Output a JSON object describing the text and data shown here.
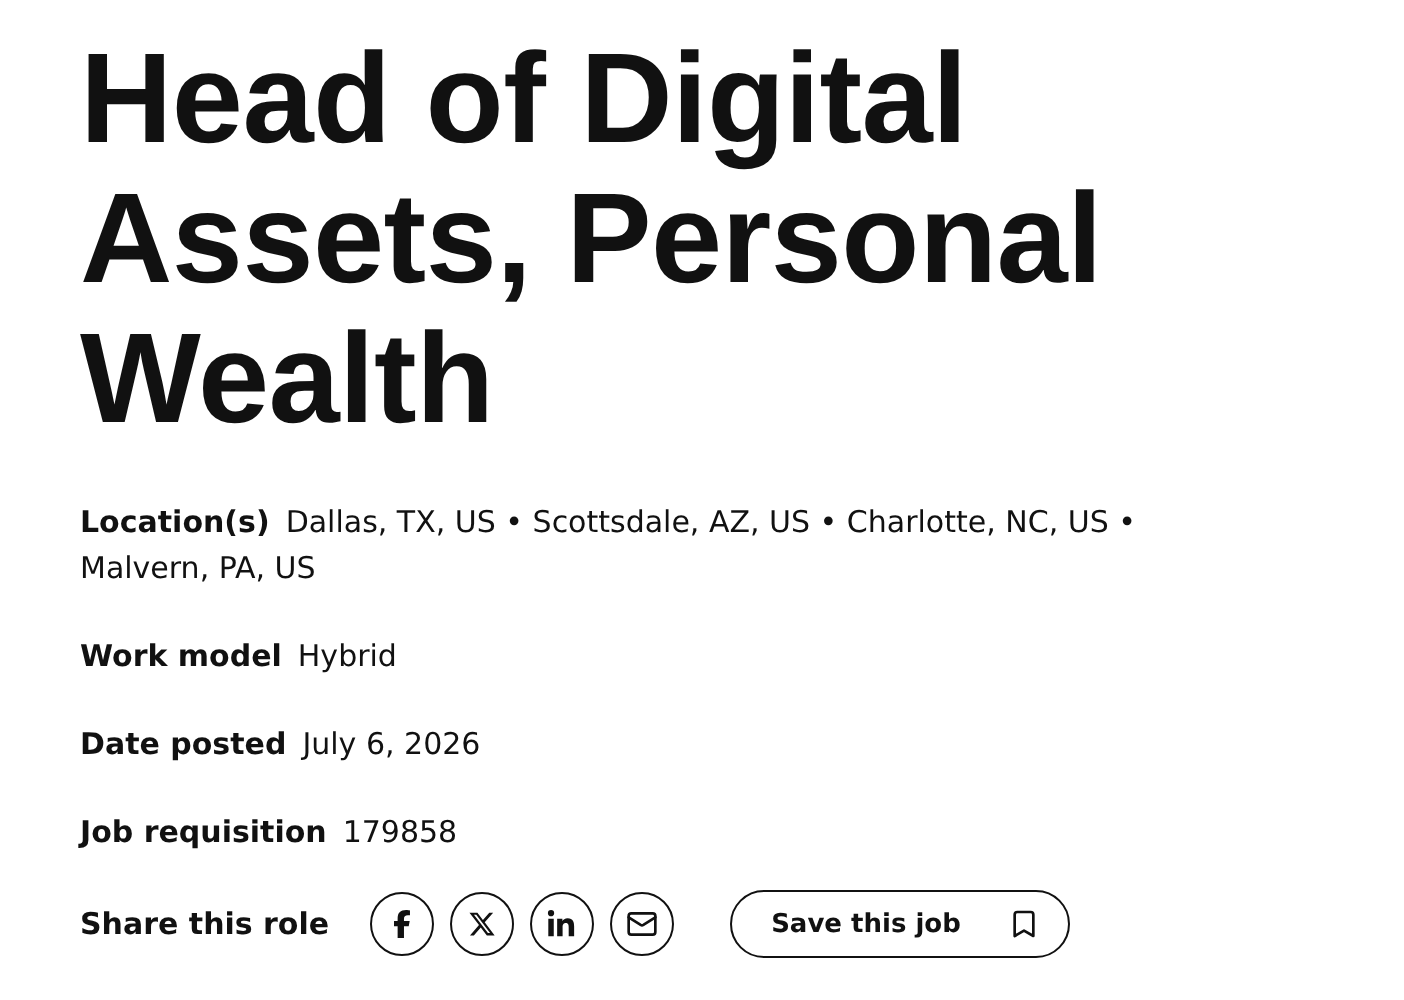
{
  "title": "Head of Digital Assets, Personal Wealth",
  "details": [
    {
      "label": "Location(s)",
      "value": "Dallas, TX, US • Scottsdale, AZ, US • Charlotte, NC, US • Malvern, PA, US"
    },
    {
      "label": "Work model",
      "value": "Hybrid"
    },
    {
      "label": "Date posted",
      "value": "July 6, 2026"
    },
    {
      "label": "Job requisition",
      "value": "179858"
    }
  ],
  "share": {
    "label": "Share this role",
    "networks": [
      {
        "kind": "facebook"
      },
      {
        "kind": "x"
      },
      {
        "kind": "linkedin"
      },
      {
        "kind": "email"
      }
    ]
  },
  "save_button": {
    "label": "Save this job"
  }
}
